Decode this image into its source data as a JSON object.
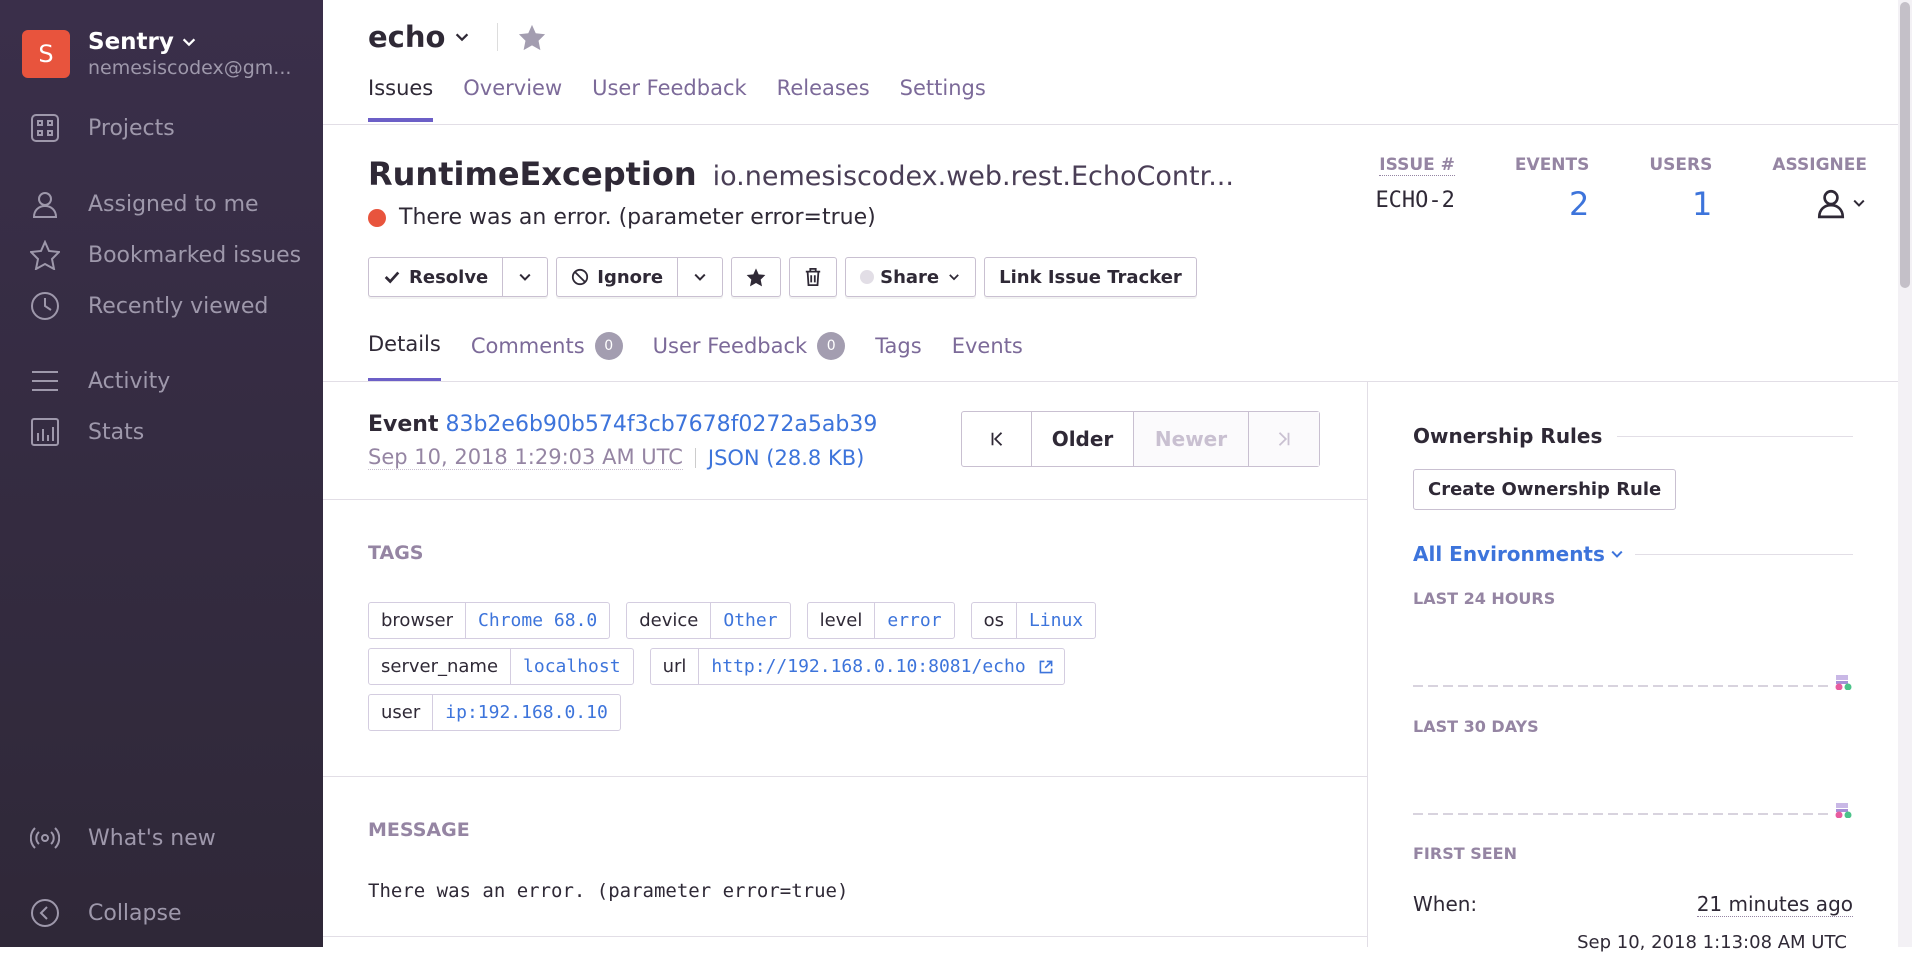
{
  "org": {
    "initial": "S",
    "name": "Sentry",
    "email": "nemesiscodex@gm..."
  },
  "sidebar": {
    "items": [
      {
        "label": "Projects",
        "icon": "projects-icon"
      },
      {
        "label": "Assigned to me",
        "icon": "user-icon"
      },
      {
        "label": "Bookmarked issues",
        "icon": "star-icon"
      },
      {
        "label": "Recently viewed",
        "icon": "clock-icon"
      },
      {
        "label": "Activity",
        "icon": "activity-icon"
      },
      {
        "label": "Stats",
        "icon": "stats-icon"
      }
    ],
    "bottom": [
      {
        "label": "What's new",
        "icon": "broadcast-icon"
      },
      {
        "label": "Collapse",
        "icon": "collapse-icon"
      }
    ]
  },
  "project": {
    "name": "echo",
    "tabs": [
      "Issues",
      "Overview",
      "User Feedback",
      "Releases",
      "Settings"
    ],
    "active_tab": "Issues"
  },
  "issue": {
    "type": "RuntimeException",
    "culprit": "io.nemesiscodex.web.rest.EchoContr...",
    "message": "There was an error. (parameter error=true)",
    "level_color": "#e8543d",
    "stats": {
      "issue_label": "ISSUE #",
      "issue_id": "ECHO-2",
      "events_label": "EVENTS",
      "events": "2",
      "users_label": "USERS",
      "users": "1",
      "assignee_label": "ASSIGNEE"
    },
    "actions": {
      "resolve": "Resolve",
      "ignore": "Ignore",
      "share": "Share",
      "link": "Link Issue Tracker"
    },
    "tabs": {
      "details": "Details",
      "comments": "Comments",
      "comments_count": "0",
      "feedback": "User Feedback",
      "feedback_count": "0",
      "tags": "Tags",
      "events": "Events"
    }
  },
  "event": {
    "label": "Event",
    "id": "83b2e6b90b574f3cb7678f0272a5ab39",
    "date": "Sep 10, 2018 1:29:03 AM UTC",
    "json": "JSON (28.8 KB)",
    "pager": {
      "older": "Older",
      "newer": "Newer"
    }
  },
  "tags_section": {
    "title": "TAGS",
    "rows": [
      [
        {
          "k": "browser",
          "v": "Chrome 68.0"
        },
        {
          "k": "device",
          "v": "Other"
        },
        {
          "k": "level",
          "v": "error"
        },
        {
          "k": "os",
          "v": "Linux"
        }
      ],
      [
        {
          "k": "server_name",
          "v": "localhost"
        },
        {
          "k": "url",
          "v": "http://192.168.0.10:8081/echo"
        }
      ],
      [
        {
          "k": "user",
          "v": "ip:192.168.0.10"
        }
      ]
    ]
  },
  "message_section": {
    "title": "MESSAGE",
    "text": "There was an error. (parameter error=true)"
  },
  "right": {
    "ownership_title": "Ownership Rules",
    "create_rule": "Create Ownership Rule",
    "environments": "All Environments",
    "last24": "LAST 24 HOURS",
    "last30": "LAST 30 DAYS",
    "first_seen": "FIRST SEEN",
    "when_label": "When:",
    "when_value": "21 minutes ago",
    "when_date": "Sep 10, 2018 1:13:08 AM UTC"
  }
}
